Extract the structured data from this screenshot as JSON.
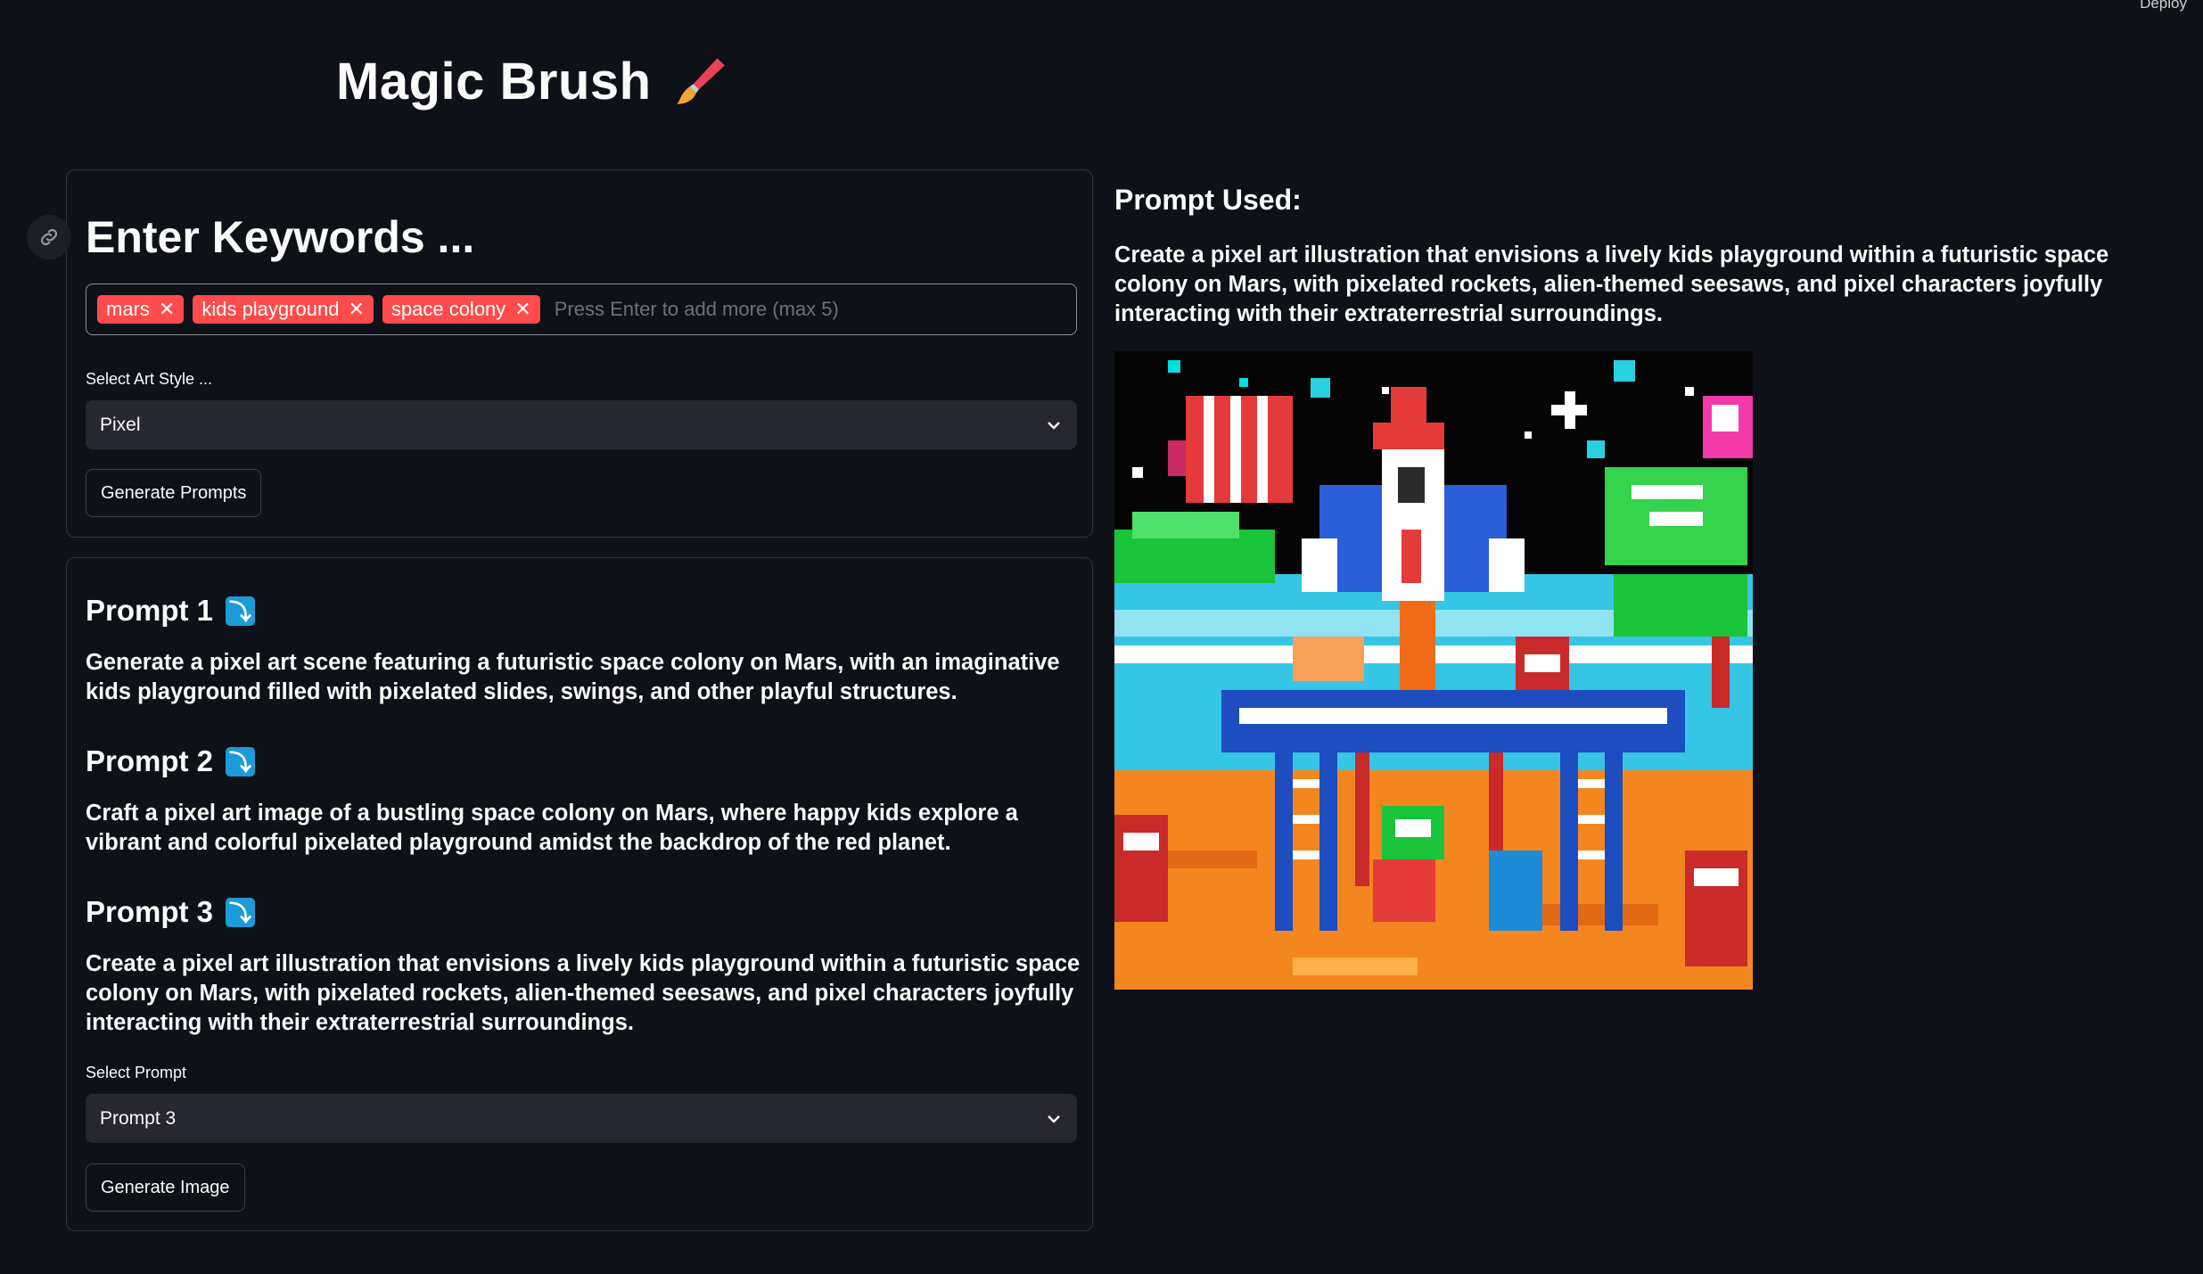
{
  "header": {
    "title": "Magic Brush",
    "deploy_label": "Deploy"
  },
  "keywords": {
    "heading": "Enter Keywords ...",
    "tags": [
      "mars",
      "kids playground",
      "space colony"
    ],
    "placeholder": "Press Enter to add more (max 5)"
  },
  "art_style": {
    "label": "Select Art Style ...",
    "value": "Pixel"
  },
  "generate_prompts_label": "Generate Prompts",
  "prompts": [
    {
      "title": "Prompt 1",
      "text": "Generate a pixel art scene featuring a futuristic space colony on Mars, with an imaginative kids playground filled with pixelated slides, swings, and other playful structures."
    },
    {
      "title": "Prompt 2",
      "text": "Craft a pixel art image of a bustling space colony on Mars, where happy kids explore a vibrant and colorful pixelated playground amidst the backdrop of the red planet."
    },
    {
      "title": "Prompt 3",
      "text": "Create a pixel art illustration that envisions a lively kids playground within a futuristic space colony on Mars, with pixelated rockets, alien-themed seesaws, and pixel characters joyfully interacting with their extraterrestrial surroundings."
    }
  ],
  "prompt_select": {
    "label": "Select Prompt",
    "value": "Prompt 3"
  },
  "generate_image_label": "Generate Image",
  "result": {
    "heading": "Prompt Used:",
    "text": "Create a pixel art illustration that envisions a lively kids playground within a futuristic space colony on Mars, with pixelated rockets, alien-themed seesaws, and pixel characters joyfully interacting with their extraterrestrial surroundings."
  },
  "colors": {
    "accent": "#ff4b4b",
    "background": "#0e1117",
    "badge": "#1b9bd7"
  }
}
